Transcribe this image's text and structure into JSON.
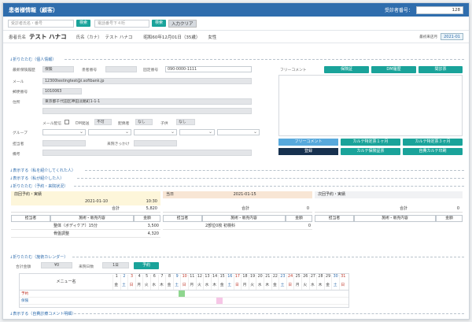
{
  "window": {
    "title": "患者様情報（顧客）",
    "reception_label": "受診者番号：",
    "reception_value": "128"
  },
  "search": {
    "name_placeholder": "受診者氏名・番号",
    "search_btn": "検索",
    "phone_placeholder": "電話番号下４桁",
    "search_btn2": "検索",
    "clear_btn": "入力クリア"
  },
  "patient": {
    "name_label": "患者氏名",
    "name": "テスト ハナコ",
    "kana_label": "氏名（カナ）",
    "kana": "テスト ハナコ",
    "birth": "昭和60年12月01日（35歳）",
    "sex": "女性",
    "first_visit_label": "最初来店月",
    "first_visit": "2021-01"
  },
  "sections": {
    "personal": "↓折りたたむ（個人情報）",
    "introduced_by": "↓表示する（私を紹介してくれた人）",
    "introduced": "↓表示する（私が紹介した人）",
    "reservation": "↓折りたたむ（予約・来院状況）",
    "calendar": "↓折りたたむ（施術カレンダー）",
    "comments": "↓表示する（自費診療コメント明細）"
  },
  "fields": {
    "insurance_label": "最新保険履歴",
    "insurance": "保険",
    "clinic_label": "患者番号",
    "clinic": "",
    "phone_label": "固定番号",
    "phone": "090-0000-1111",
    "mail_label": "メール",
    "mail": "12300testingtest@i.softbank.jp",
    "zip_label": "郵便番号",
    "zip": "1010063",
    "address_label": "住所",
    "address": "東京都千代田区神田淡路町1-1-1",
    "mail_send_label": "メール配信",
    "dm_label": "DM発送",
    "dm": "不可",
    "spouse_label": "配偶者",
    "spouse": "なし",
    "child_label": "子供",
    "child": "なし",
    "group_label": "グループ",
    "staff_label": "担当者",
    "trigger_label": "来院きっかけ",
    "note_label": "備考"
  },
  "free_comment": {
    "label": "フリーコメント",
    "buttons": [
      "保険証",
      "DM履歴",
      "間診票"
    ],
    "row1": [
      "フリーコメント",
      "カルテ特定票１ヶ月",
      "カルテ特定票３ヶ月"
    ],
    "row2": [
      "登録",
      "カルテ保険証票",
      "自費カルテ印刷"
    ]
  },
  "visits": {
    "prev": {
      "title": "前回予約・実績",
      "date": "2021-01-10",
      "time": "10:30",
      "total_label": "合計",
      "total": "5,820",
      "headers": [
        "担当者",
        "施術・販売内容",
        "金額"
      ],
      "rows": [
        [
          "",
          "整体（ボディケア）15分",
          "3,500"
        ],
        [
          "",
          "骨盤調整",
          "4,320"
        ]
      ]
    },
    "today": {
      "title": "当日",
      "date": "2021-01-15",
      "total_label": "合計",
      "total": "0",
      "headers": [
        "担当者",
        "施術・販売内容",
        "金額"
      ],
      "rows": [
        [
          "",
          "2部位0枚 初検科",
          "0"
        ]
      ]
    },
    "next": {
      "title": "次回予約・実績",
      "total_label": "合計",
      "total": "0",
      "headers": [
        "担当者",
        "施術・販売内容",
        "金額"
      ]
    }
  },
  "calendar": {
    "total_label": "合計金額",
    "total": "¥0",
    "days_label": "来院日数",
    "days": "1日",
    "reserve_btn": "予約",
    "menu_label": "メニュー名",
    "dates": [
      "1",
      "2",
      "3",
      "4",
      "5",
      "6",
      "7",
      "8",
      "9",
      "10",
      "11",
      "12",
      "13",
      "14",
      "15",
      "16",
      "17",
      "18",
      "19",
      "20",
      "21",
      "22",
      "23",
      "24",
      "25",
      "26",
      "27",
      "28",
      "29",
      "30",
      "31"
    ],
    "weekdays": [
      "金",
      "土",
      "日",
      "月",
      "火",
      "水",
      "木",
      "金",
      "土",
      "日",
      "月",
      "火",
      "水",
      "木",
      "金",
      "土",
      "日",
      "月",
      "火",
      "水",
      "木",
      "金",
      "土",
      "日",
      "月",
      "火",
      "水",
      "木",
      "金",
      "土",
      "日"
    ],
    "rows": [
      "予約",
      "保険"
    ]
  },
  "colors": {
    "header": "#2f6dad",
    "teal": "#1aa39a",
    "blue": "#58a9dc",
    "dark": "#17314f",
    "prev_bg": "#fdf6da",
    "today_bg": "#f8e6d5"
  }
}
